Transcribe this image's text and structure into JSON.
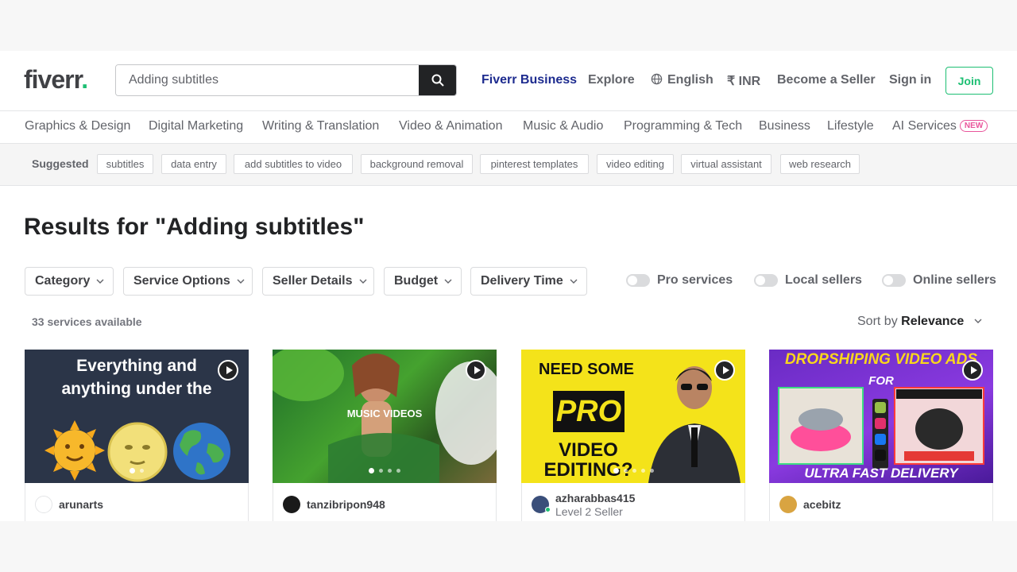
{
  "header": {
    "logo": "fiverr",
    "logo_dot": ".",
    "search_value": "Adding subtitles",
    "nav": {
      "business": "Fiverr Business",
      "explore": "Explore",
      "language": "English",
      "currency": "₹ INR",
      "become_seller": "Become a Seller",
      "sign_in": "Sign in",
      "join": "Join"
    }
  },
  "categories": [
    "Graphics & Design",
    "Digital Marketing",
    "Writing & Translation",
    "Video & Animation",
    "Music & Audio",
    "Programming & Tech",
    "Business",
    "Lifestyle",
    "AI Services"
  ],
  "new_badge": "NEW",
  "suggested": {
    "label": "Suggested",
    "chips": [
      "subtitles",
      "data entry",
      "add subtitles to video",
      "background removal",
      "pinterest templates",
      "video editing",
      "virtual assistant",
      "web research"
    ]
  },
  "results": {
    "title": "Results for \"Adding subtitles\"",
    "filters": [
      "Category",
      "Service Options",
      "Seller Details",
      "Budget",
      "Delivery Time"
    ],
    "toggles": [
      "Pro services",
      "Local sellers",
      "Online sellers"
    ],
    "count": "33 services available",
    "sort_label": "Sort by",
    "sort_value": "Relevance"
  },
  "gigs": [
    {
      "seller": "arunarts",
      "thumb_text_1": "Everything and",
      "thumb_text_2": "anything under the",
      "bg": "#2b3548"
    },
    {
      "seller": "tanzibripon948",
      "thumb_text": "MUSIC VIDEOS",
      "bg": "#3f8f2a"
    },
    {
      "seller": "azharabbas415",
      "level": "Level 2 Seller",
      "text_a": "NEED SOME",
      "text_pro": "PRO",
      "text_b1": "VIDEO",
      "text_b2": "EDITING?",
      "bg": "#f4e31a"
    },
    {
      "seller": "acebitz",
      "title": "DROPSHIPING VIDEO ADS",
      "for": "FOR",
      "bottom": "ULTRA FAST DELIVERY",
      "bg": "#7b2fd0"
    }
  ],
  "colors": {
    "brand_green": "#1dbf73",
    "business_blue": "#1d2b8f",
    "new_pink": "#e9559b"
  }
}
